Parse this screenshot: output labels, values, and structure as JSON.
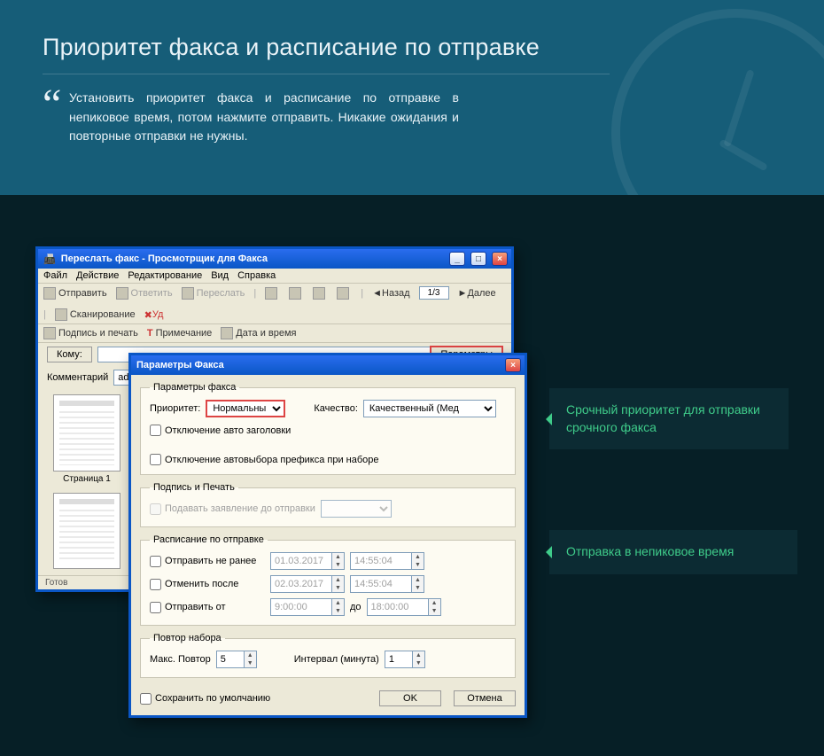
{
  "hero": {
    "title": "Приоритет факса и расписание по отправке",
    "body": "Установить приоритет факса и расписание по отправке в непиковое время, потом нажмите отправить. Никакие ожидания и повторные отправки не нужны."
  },
  "callouts": {
    "priority": "Срочный приоритет для отправки срочного факса",
    "schedule": "Отправка в непиковое время"
  },
  "viewer": {
    "title": "Переслать факс - Просмотрщик для Факса",
    "menu": [
      "Файл",
      "Действие",
      "Редактирование",
      "Вид",
      "Справка"
    ],
    "toolbar1": {
      "send": "Отправить",
      "reply": "Ответить",
      "forward": "Переслать",
      "back": "Назад",
      "page": "1/3",
      "next": "Далее",
      "scan": "Сканирование",
      "delete_prefix": "Уд"
    },
    "toolbar2": {
      "sign": "Подпись и печать",
      "note": "Примечание",
      "date": "Дата и время"
    },
    "to_label": "Кому:",
    "params_btn": "Параметры",
    "comment_label": "Комментарий",
    "comment_value": "admin:Отвечено",
    "page_label": "Страница 1",
    "status": "Готов"
  },
  "params": {
    "title": "Параметры Факса",
    "group_params": "Параметры факса",
    "priority_label": "Приоритет:",
    "priority_value": "Нормальны",
    "quality_label": "Качество:",
    "quality_value": "Качественный (Мед",
    "chk_auto_header": "Отключение авто заголовки",
    "chk_auto_prefix": "Отключение автовыбора префикса при наборе",
    "group_sign": "Подпись и Печать",
    "sign_apply": "Подавать заявление до отправки",
    "group_schedule": "Расписание по отправке",
    "chk_not_before": "Отправить не ранее",
    "chk_cancel_after": "Отменить после",
    "chk_send_from": "Отправить от",
    "date1": "01.03.2017",
    "time1": "14:55:04",
    "date2": "02.03.2017",
    "time2": "14:55:04",
    "from_time": "9:00:00",
    "to_label": "до",
    "to_time": "18:00:00",
    "group_retry": "Повтор набора",
    "max_retry_label": "Макс. Повтор",
    "max_retry_value": "5",
    "interval_label": "Интервал (минута)",
    "interval_value": "1",
    "save_default": "Сохранить по умолчанию",
    "ok": "OK",
    "cancel": "Отмена"
  }
}
